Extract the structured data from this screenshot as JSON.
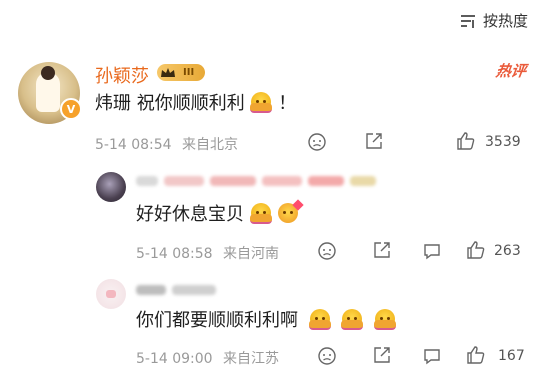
{
  "sort": {
    "label": "按热度"
  },
  "main_comment": {
    "username": "孙颖莎",
    "level": "III",
    "hot_tag": "热评",
    "text": "炜珊 祝你顺顺利利",
    "text_suffix": "！",
    "date": "5-14 08:54",
    "location": "来自北京",
    "likes": "3539"
  },
  "replies": [
    {
      "text": "好好休息宝贝",
      "date": "5-14 08:58",
      "location": "来自河南",
      "likes": "263"
    },
    {
      "text": "你们都要顺顺利利啊",
      "date": "5-14 09:00",
      "location": "来自江苏",
      "likes": "167"
    }
  ],
  "colors": {
    "username": "#e9691d",
    "hot_tag": "#ea5b3b",
    "meta": "#9a9a9a"
  }
}
